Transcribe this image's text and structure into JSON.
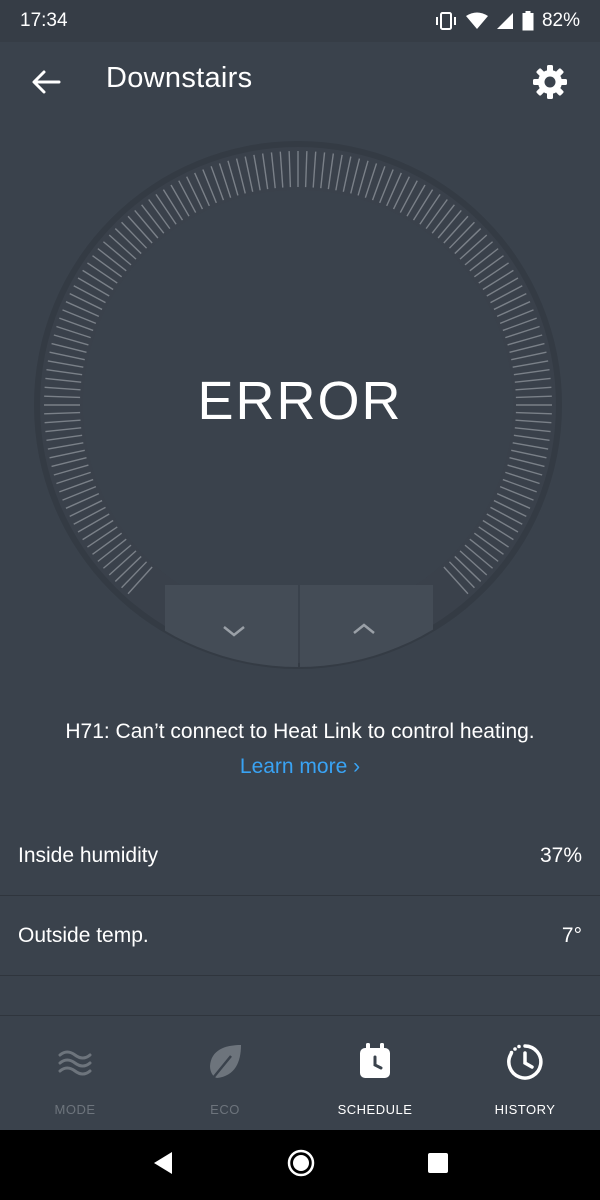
{
  "status_bar": {
    "time": "17:34",
    "battery": "82%"
  },
  "app_bar": {
    "title": "Downstairs",
    "back_icon": "arrow-left-icon",
    "settings_icon": "gear-icon"
  },
  "dial": {
    "status_text": "ERROR",
    "down_icon": "chevron-down-icon",
    "up_icon": "chevron-up-icon"
  },
  "error": {
    "message": "H71: Can’t connect to Heat Link to control heating.",
    "link_label": "Learn more ›"
  },
  "info_rows": [
    {
      "label": "Inside humidity",
      "value": "37%"
    },
    {
      "label": "Outside temp.",
      "value": "7°"
    }
  ],
  "bottom_nav": {
    "items": [
      {
        "label": "MODE",
        "icon": "waves-icon",
        "enabled": false
      },
      {
        "label": "ECO",
        "icon": "leaf-icon",
        "enabled": false
      },
      {
        "label": "SCHEDULE",
        "icon": "calendar-clock-icon",
        "enabled": true
      },
      {
        "label": "HISTORY",
        "icon": "history-clock-icon",
        "enabled": true
      }
    ]
  },
  "colors": {
    "background": "#3a424c",
    "accent_link": "#39a3f4",
    "disabled": "#6d747c"
  }
}
